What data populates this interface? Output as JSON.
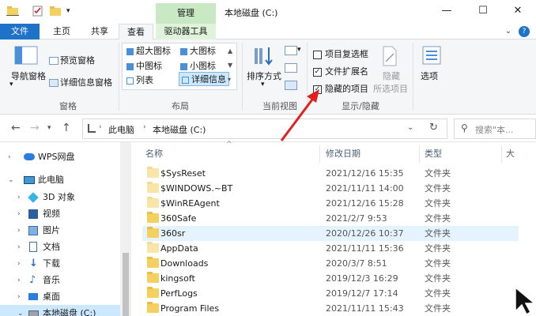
{
  "window": {
    "manage_tab": "管理",
    "title": "本地磁盘 (C:)",
    "minimize": "—",
    "maximize": "☐",
    "close": "✕"
  },
  "ribbon_tabs": [
    {
      "label": "文件"
    },
    {
      "label": "主页"
    },
    {
      "label": "共享"
    },
    {
      "label": "查看"
    },
    {
      "label": "驱动器工具"
    }
  ],
  "help_icon": "?",
  "ribbon": {
    "panes": {
      "nav_pane": "导航窗格",
      "preview": "预览窗格",
      "details": "详细信息窗格",
      "group": "窗格"
    },
    "layout": {
      "items": [
        "超大图标",
        "大图标",
        "中图标",
        "小图标",
        "列表",
        "详细信息"
      ],
      "group": "布局"
    },
    "current_view": {
      "sort": "排序方式",
      "group": "当前视图"
    },
    "show_hide": {
      "item_checkbox": "项目复选框",
      "file_ext": "文件扩展名",
      "hidden_items": "隐藏的项目",
      "hide": "隐藏",
      "selected_items": "所选项目",
      "group": "显示/隐藏"
    },
    "options": "选项"
  },
  "address": {
    "path_root": "此电脑",
    "path_current": "本地磁盘 (C:)",
    "search_placeholder": "搜索\"本..."
  },
  "nav_tree": [
    {
      "label": "WPS网盘"
    },
    {
      "label": "此电脑"
    },
    {
      "label": "3D 对象"
    },
    {
      "label": "视频"
    },
    {
      "label": "图片"
    },
    {
      "label": "文档"
    },
    {
      "label": "下载"
    },
    {
      "label": "音乐"
    },
    {
      "label": "桌面"
    },
    {
      "label": "本地磁盘 (C:)"
    }
  ],
  "columns": {
    "name": "名称",
    "date": "修改日期",
    "type": "类型",
    "size": "大"
  },
  "files": [
    {
      "name": "$SysReset",
      "date": "2021/12/16 15:35",
      "type": "文件夹"
    },
    {
      "name": "$WINDOWS.~BT",
      "date": "2021/11/11 14:00",
      "type": "文件夹"
    },
    {
      "name": "$WinREAgent",
      "date": "2021/12/16 15:28",
      "type": "文件夹"
    },
    {
      "name": "360Safe",
      "date": "2021/2/7 9:53",
      "type": "文件夹"
    },
    {
      "name": "360sr",
      "date": "2020/12/26 10:37",
      "type": "文件夹"
    },
    {
      "name": "AppData",
      "date": "2021/11/11 15:36",
      "type": "文件夹"
    },
    {
      "name": "Downloads",
      "date": "2020/3/7 8:51",
      "type": "文件夹"
    },
    {
      "name": "kingsoft",
      "date": "2019/12/3 16:29",
      "type": "文件夹"
    },
    {
      "name": "PerfLogs",
      "date": "2019/12/7 17:14",
      "type": "文件夹"
    },
    {
      "name": "Program Files",
      "date": "2021/11/11 15:43",
      "type": "文件夹"
    }
  ],
  "colors": {
    "file_tab": "#1e73c8",
    "manage_tab": "#c9e9c4",
    "selection": "#cce8ff",
    "folder": "#f3d060",
    "annotation_arrow": "#e02020"
  }
}
